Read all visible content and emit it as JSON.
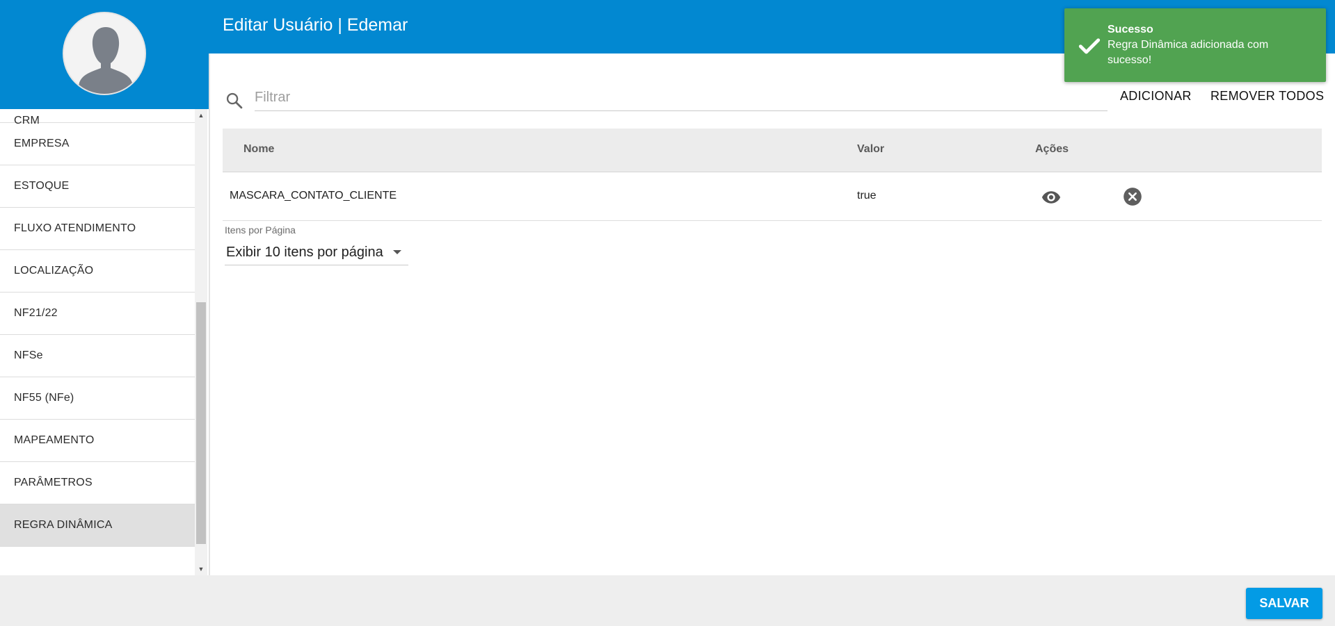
{
  "header": {
    "title": "Editar Usuário | Edemar"
  },
  "sidebar": {
    "items": [
      {
        "label": "CRM"
      },
      {
        "label": "EMPRESA"
      },
      {
        "label": "ESTOQUE"
      },
      {
        "label": "FLUXO ATENDIMENTO"
      },
      {
        "label": "LOCALIZAÇÃO"
      },
      {
        "label": "NF21/22"
      },
      {
        "label": "NFSe"
      },
      {
        "label": "NF55 (NFe)"
      },
      {
        "label": "MAPEAMENTO"
      },
      {
        "label": "PARÂMETROS"
      },
      {
        "label": "REGRA DINÂMICA",
        "active": true
      }
    ]
  },
  "filter": {
    "placeholder": "Filtrar",
    "value": ""
  },
  "toolbar": {
    "add_label": "ADICIONAR",
    "remove_all_label": "REMOVER TODOS"
  },
  "table": {
    "columns": {
      "name": "Nome",
      "value": "Valor",
      "actions": "Ações"
    },
    "rows": [
      {
        "name": "MASCARA_CONTATO_CLIENTE",
        "value": "true"
      }
    ]
  },
  "pagination": {
    "label": "Itens por Página",
    "selected": "Exibir 10 itens por página"
  },
  "footer": {
    "save_label": "SALVAR"
  },
  "toast": {
    "title": "Sucesso",
    "message": "Regra Dinâmica adicionada com sucesso!"
  },
  "colors": {
    "primary": "#0288d1",
    "save": "#039be5",
    "toast": "#51a351"
  }
}
